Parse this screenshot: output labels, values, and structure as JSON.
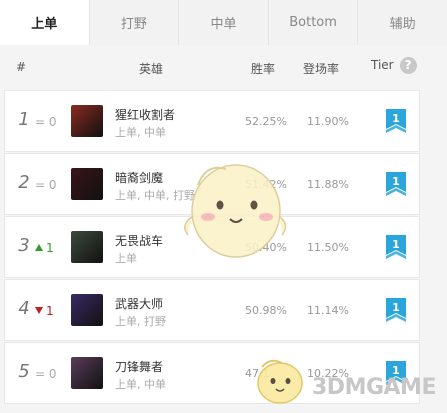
{
  "tabs": [
    {
      "label": "上单",
      "active": true
    },
    {
      "label": "打野",
      "active": false
    },
    {
      "label": "中单",
      "active": false
    },
    {
      "label": "Bottom",
      "active": false
    },
    {
      "label": "辅助",
      "active": false
    }
  ],
  "header": {
    "rank": "#",
    "hero": "英雄",
    "winrate": "胜率",
    "pickrate": "登场率",
    "tier": "Tier",
    "help": "?"
  },
  "rows": [
    {
      "rank": "1",
      "change": "= 0",
      "trend": "same",
      "name": "猩红收割者",
      "roles": "上单, 中单",
      "winrate": "52.25%",
      "pickrate": "11.90%",
      "tier": "1",
      "avatar_color": "#8a2a22"
    },
    {
      "rank": "2",
      "change": "= 0",
      "trend": "same",
      "name": "暗裔剑魔",
      "roles": "上单, 中单, 打野",
      "winrate": "51.42%",
      "pickrate": "11.88%",
      "tier": "1",
      "avatar_color": "#3a1418"
    },
    {
      "rank": "3",
      "change": "1",
      "trend": "up",
      "name": "无畏战车",
      "roles": "上单",
      "winrate": "50.40%",
      "pickrate": "11.50%",
      "tier": "1",
      "avatar_color": "#3d4a3c"
    },
    {
      "rank": "4",
      "change": "1",
      "trend": "down",
      "name": "武器大师",
      "roles": "上单, 打野",
      "winrate": "50.98%",
      "pickrate": "11.14%",
      "tier": "1",
      "avatar_color": "#3a2a66"
    },
    {
      "rank": "5",
      "change": "= 0",
      "trend": "same",
      "name": "刀锋舞者",
      "roles": "上单, 中单",
      "winrate": "47.1",
      "pickrate": "10.22%",
      "tier": "1",
      "avatar_color": "#5a3c5a"
    }
  ],
  "watermark": "3DMGAME",
  "colors": {
    "tier_badge": "#2aa6dc",
    "active_tab_bg": "#ffffff",
    "up": "#2e9d2e",
    "down": "#bb2222"
  }
}
